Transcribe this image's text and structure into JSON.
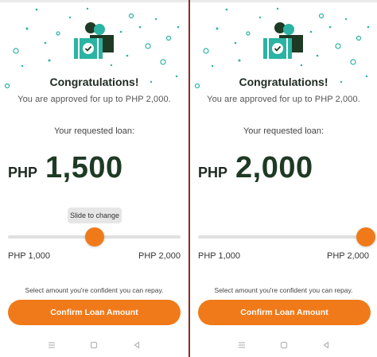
{
  "screens": [
    {
      "title": "Congratulations!",
      "approved_text": "You are approved for up to PHP 2,000.",
      "requested_label": "Your requested loan:",
      "currency": "PHP",
      "amount": "1,500",
      "slider": {
        "tooltip": "Slide to change",
        "min_label": "PHP 1,000",
        "max_label": "PHP 2,000",
        "level": 0.5
      },
      "hint": "Select amount you're confident you can repay.",
      "confirm_label": "Confirm Loan Amount"
    },
    {
      "title": "Congratulations!",
      "approved_text": "You are approved for up to PHP 2,000.",
      "requested_label": "Your requested loan:",
      "currency": "PHP",
      "amount": "2,000",
      "slider": {
        "tooltip": "",
        "min_label": "PHP 1,000",
        "max_label": "PHP 2,000",
        "level": 1.0
      },
      "hint": "Select amount you're confident you can repay.",
      "confirm_label": "Confirm Loan Amount"
    }
  ],
  "colors": {
    "accent": "#f07a1a",
    "teal": "#2bb3a3",
    "dark_green": "#1e3a24",
    "divider": "#8a2d22"
  },
  "icons": {
    "illustration": "approved-ticket-icon",
    "nav": [
      "menu-icon",
      "home-square-icon",
      "back-triangle-icon"
    ]
  }
}
